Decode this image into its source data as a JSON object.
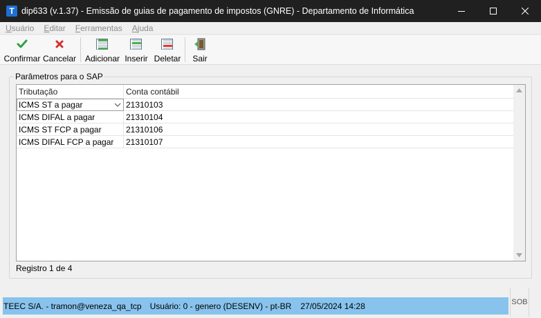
{
  "window": {
    "app_letter": "T",
    "title": "dip633 (v.1.37) - Emissão de guias de pagamento de impostos (GNRE) - Departamento de Informática"
  },
  "menu": [
    {
      "first": "U",
      "rest": "suário"
    },
    {
      "first": "E",
      "rest": "ditar"
    },
    {
      "first": "F",
      "rest": "erramentas"
    },
    {
      "first": "A",
      "rest": "juda"
    }
  ],
  "toolbar": {
    "confirm_label": "Confirmar",
    "cancel_label": "Cancelar",
    "add_label": "Adicionar",
    "insert_label": "Inserir",
    "delete_label": "Deletar",
    "exit_label": "Sair"
  },
  "group": {
    "title": "Parâmetros para o SAP"
  },
  "grid": {
    "columns": [
      "Tributação",
      "Conta contábil"
    ],
    "rows": [
      {
        "tributacao": "ICMS ST a pagar",
        "conta": "21310103"
      },
      {
        "tributacao": "ICMS DIFAL a pagar",
        "conta": "21310104"
      },
      {
        "tributacao": "ICMS ST FCP a pagar",
        "conta": "21310106"
      },
      {
        "tributacao": "ICMS DIFAL FCP a pagar",
        "conta": "21310107"
      }
    ]
  },
  "record_status": "Registro 1 de 4",
  "statusbar": {
    "company": "TEEC S/A. - tramon@veneza_qa_tcp",
    "user": "Usuário: 0 - genero (DESENV) - pt-BR",
    "datetime": "27/05/2024 14:28",
    "sob": "SOB"
  },
  "colors": {
    "titlebar": "#202020",
    "statusbar": "#87c3ed",
    "confirm_green": "#2ea043",
    "cancel_red": "#d32f2f"
  }
}
